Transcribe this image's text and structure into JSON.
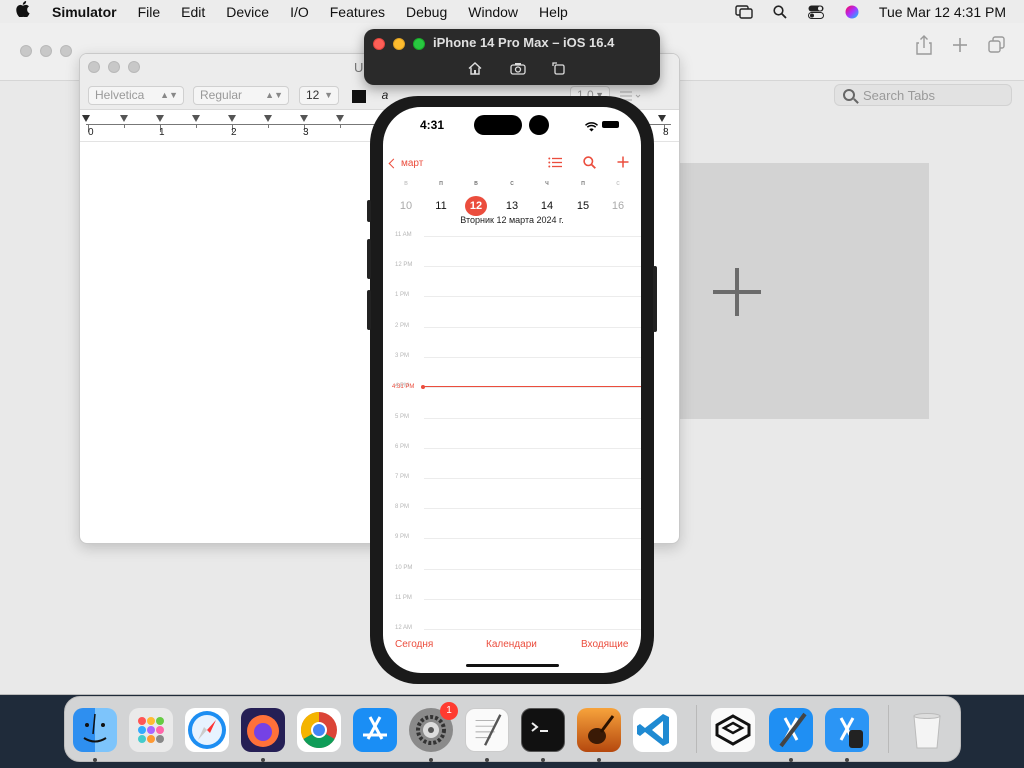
{
  "menubar": {
    "app_name": "Simulator",
    "items": [
      "File",
      "Edit",
      "Device",
      "I/O",
      "Features",
      "Debug",
      "Window",
      "Help"
    ],
    "clock": "Tue Mar 12  4:31 PM"
  },
  "browser": {
    "search_placeholder": "Search Tabs"
  },
  "textedit": {
    "title": "U",
    "font_family": "Helvetica",
    "font_style": "Regular",
    "font_size": "12",
    "line_spacing": "1.0",
    "ruler_labels": [
      "0",
      "1",
      "2",
      "3",
      "8"
    ]
  },
  "simulator": {
    "title": "iPhone 14 Pro Max – iOS 16.4",
    "buttons": [
      "home-icon",
      "screenshot-icon",
      "rotate-icon"
    ]
  },
  "phone": {
    "status_time": "4:31",
    "calendar": {
      "back_label": "март",
      "weekday_letters": [
        "в",
        "п",
        "в",
        "с",
        "ч",
        "п",
        "с"
      ],
      "week_days": [
        "10",
        "11",
        "12",
        "13",
        "14",
        "15",
        "16"
      ],
      "selected_day": "12",
      "date_line": "Вторник   12 марта 2024 г.",
      "hours": [
        "11 AM",
        "12 PM",
        "1 PM",
        "2 PM",
        "3 PM",
        "4 PM",
        "5 PM",
        "6 PM",
        "7 PM",
        "8 PM",
        "9 PM",
        "10 PM",
        "11 PM",
        "12 AM"
      ],
      "now_label": "4:31 PM",
      "tab_today": "Сегодня",
      "tab_calendars": "Календари",
      "tab_inbox": "Входящие",
      "accent_color": "#eb4d3d"
    }
  },
  "dock": {
    "apps": [
      "Finder",
      "Launchpad",
      "Safari",
      "Firefox",
      "Chrome",
      "App Store",
      "System Settings",
      "TextEdit",
      "Terminal",
      "GarageBand",
      "Visual Studio Code",
      "Xcode Cloud",
      "Xcode",
      "Simulator",
      "Trash"
    ],
    "settings_badge": "1"
  }
}
